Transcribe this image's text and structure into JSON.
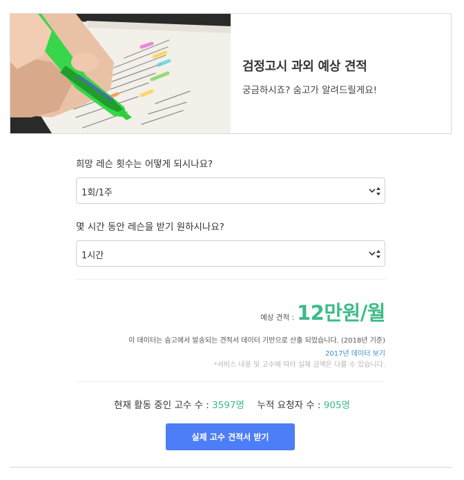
{
  "hero": {
    "title": "검정고시 과외 예상 견적",
    "subtitle": "궁금하시죠? 숨고가 알려드릴게요!"
  },
  "form": {
    "q1_label": "희망 레슨 횟수는 어떻게 되시나요?",
    "q1_value": "1회/1주",
    "q2_label": "몇 시간 동안 레슨을 받기 원하시나요?",
    "q2_value": "1시간"
  },
  "estimate": {
    "label": "예상 견적 :",
    "value": "12만원/월"
  },
  "notes": {
    "source": "이 데이터는 숨고에서 발송되는 견적서 데이터 기반으로 산출 되었습니다. (2018년 기준)",
    "link": "2017년 데이터 보기",
    "disclaimer": "*서비스 내용 및 고수에 따라 실제 금액은 다를 수 있습니다."
  },
  "stats": {
    "active_label": "현재 활동 중인 고수 수 :",
    "active_value": "3597명",
    "requests_label": "누적 요청자 수 :",
    "requests_value": "905명"
  },
  "cta": {
    "label": "실제 고수 견적서 받기"
  },
  "colors": {
    "accent_green": "#3dbb87",
    "button_blue": "#4d7ef7",
    "link_blue": "#3b8bd8"
  },
  "icons": {
    "select_arrow": "chevron-updown-icon",
    "hero_image": "highlighter-notebook-photo"
  }
}
